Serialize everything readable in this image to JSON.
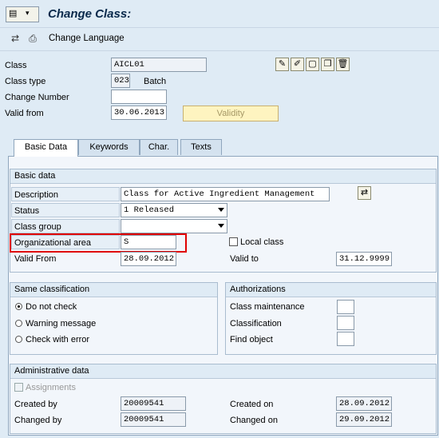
{
  "window": {
    "title": "Change Class:"
  },
  "toolbar": {
    "change_language_label": "Change Language"
  },
  "header": {
    "class_label": "Class",
    "class_value": "AICL01",
    "class_type_label": "Class type",
    "class_type_value": "023",
    "class_type_desc": "Batch",
    "change_number_label": "Change Number",
    "change_number_value": "",
    "valid_from_label": "Valid from",
    "valid_from_value": "30.06.2013",
    "validity_button": "Validity"
  },
  "tabs": [
    {
      "label": "Basic Data",
      "active": true
    },
    {
      "label": "Keywords"
    },
    {
      "label": "Char."
    },
    {
      "label": "Texts"
    }
  ],
  "basic_data": {
    "title": "Basic data",
    "description_label": "Description",
    "description_value": "Class for Active Ingredient Management",
    "status_label": "Status",
    "status_value": "1 Released",
    "class_group_label": "Class group",
    "class_group_value": "",
    "org_area_label": "Organizational area",
    "org_area_value": "S",
    "local_class_label": "Local class",
    "valid_from_label": "Valid From",
    "valid_from_value": "28.09.2012",
    "valid_to_label": "Valid to",
    "valid_to_value": "31.12.9999"
  },
  "same_classification": {
    "title": "Same classification",
    "options": [
      "Do not check",
      "Warning message",
      "Check with error"
    ],
    "selected": "Do not check"
  },
  "authorizations": {
    "title": "Authorizations",
    "class_maintenance_label": "Class maintenance",
    "classification_label": "Classification",
    "find_object_label": "Find object"
  },
  "admin_data": {
    "title": "Administrative data",
    "assignments_label": "Assignments",
    "created_by_label": "Created by",
    "created_by_value": "20009541",
    "changed_by_label": "Changed by",
    "changed_by_value": "20009541",
    "created_on_label": "Created on",
    "created_on_value": "28.09.2012",
    "changed_on_label": "Changed on",
    "changed_on_value": "29.09.2012"
  },
  "colors": {
    "background": "#dfebf5",
    "highlight_border": "#e00000",
    "validity_button": "#fef4c0"
  }
}
